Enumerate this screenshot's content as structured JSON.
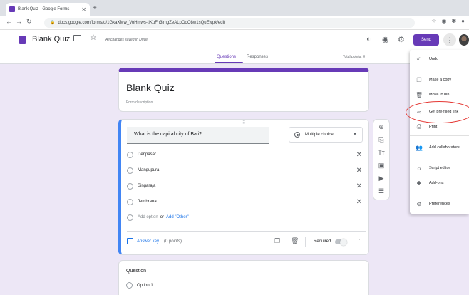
{
  "browser": {
    "tab_title": "Blank Quiz - Google Forms",
    "new_tab": "+",
    "url": "docs.google.com/forms/d/1GkaXMw_VoHmws-tiKuFn3imgZeALpOoO8w1sQuEwpk/edit"
  },
  "header": {
    "doc_title": "Blank Quiz",
    "save_status": "All changes saved in Drive",
    "send_label": "Send"
  },
  "form_tabs": {
    "questions": "Questions",
    "responses": "Responses",
    "total_points": "Total points: 0"
  },
  "title_card": {
    "title": "Blank Quiz",
    "description": "Form description"
  },
  "question": {
    "text": "What is the capital city of Bali?",
    "type": "Multiple choice",
    "options": [
      "Denpasar",
      "Mangupura",
      "Singaraja",
      "Jembrana"
    ],
    "add_option": "Add option",
    "or": "or",
    "add_other": "Add \"Other\"",
    "answer_key": "Answer key",
    "points": "(0 points)",
    "required_label": "Required"
  },
  "question2": {
    "title": "Question",
    "option": "Option 1"
  },
  "menu": {
    "items": [
      {
        "label": "Undo",
        "icon": "undo-icon"
      },
      {
        "label": "Make a copy",
        "icon": "copy-icon"
      },
      {
        "label": "Move to bin",
        "icon": "trash-icon"
      },
      {
        "label": "Get pre-filled link",
        "icon": "link-icon"
      },
      {
        "label": "Print",
        "icon": "print-icon"
      },
      {
        "label": "Add collaborators",
        "icon": "add-person-icon"
      },
      {
        "label": "Script editor",
        "icon": "code-icon"
      },
      {
        "label": "Add-ons",
        "icon": "puzzle-icon"
      },
      {
        "label": "Preferences",
        "icon": "preferences-icon"
      }
    ]
  },
  "colors": {
    "accent": "#673ab7",
    "background": "#ede7f6",
    "active_question": "#4285f4",
    "link": "#1a73e8",
    "highlight": "#e53935"
  }
}
